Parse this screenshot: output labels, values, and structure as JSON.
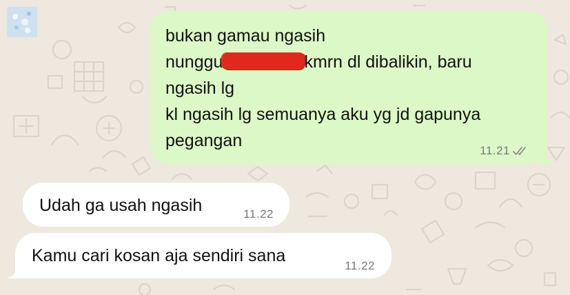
{
  "chat": {
    "outgoing": {
      "lines": [
        "bukan gamau ngasih",
        "nunggu",
        "kmrn dl dibalikin, baru",
        "ngasih lg",
        "kl ngasih lg semuanya aku yg jd gapunya",
        "pegangan"
      ],
      "time": "11.21",
      "status_icon": "double-check-icon"
    },
    "incoming": [
      {
        "text": "Udah ga usah ngasih",
        "time": "11.22"
      },
      {
        "text": "Kamu cari kosan aja sendiri sana",
        "time": "11.22"
      }
    ]
  },
  "colors": {
    "background": "#efe8df",
    "outgoing_bubble": "#dcf8c6",
    "incoming_bubble": "#ffffff",
    "redaction": "#e0281c",
    "meta_text": "#7a7a7a"
  }
}
